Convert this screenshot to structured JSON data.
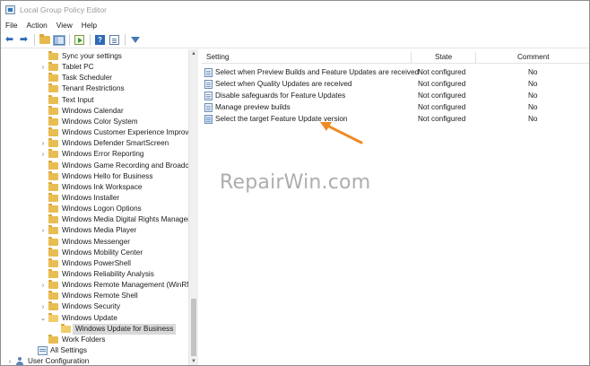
{
  "window": {
    "title": "Local Group Policy Editor"
  },
  "menu": [
    "File",
    "Action",
    "View",
    "Help"
  ],
  "toolbar": {
    "buttons": [
      "back-arrow-icon",
      "forward-arrow-icon",
      "up-folder-icon",
      "show-hide-tree-icon",
      "export-list-icon",
      "help-icon",
      "properties-icon",
      "filter-icon"
    ],
    "help_glyph": "?"
  },
  "tree": {
    "items": [
      {
        "label": "Sync your settings",
        "expandable": false
      },
      {
        "label": "Tablet PC",
        "expandable": true
      },
      {
        "label": "Task Scheduler",
        "expandable": false
      },
      {
        "label": "Tenant Restrictions",
        "expandable": false
      },
      {
        "label": "Text Input",
        "expandable": false
      },
      {
        "label": "Windows Calendar",
        "expandable": false
      },
      {
        "label": "Windows Color System",
        "expandable": false
      },
      {
        "label": "Windows Customer Experience Improve",
        "expandable": false
      },
      {
        "label": "Windows Defender SmartScreen",
        "expandable": true
      },
      {
        "label": "Windows Error Reporting",
        "expandable": true
      },
      {
        "label": "Windows Game Recording and Broadca",
        "expandable": false
      },
      {
        "label": "Windows Hello for Business",
        "expandable": false
      },
      {
        "label": "Windows Ink Workspace",
        "expandable": false
      },
      {
        "label": "Windows Installer",
        "expandable": false
      },
      {
        "label": "Windows Logon Options",
        "expandable": false
      },
      {
        "label": "Windows Media Digital Rights Manager",
        "expandable": false
      },
      {
        "label": "Windows Media Player",
        "expandable": true
      },
      {
        "label": "Windows Messenger",
        "expandable": false
      },
      {
        "label": "Windows Mobility Center",
        "expandable": false
      },
      {
        "label": "Windows PowerShell",
        "expandable": false
      },
      {
        "label": "Windows Reliability Analysis",
        "expandable": false
      },
      {
        "label": "Windows Remote Management (WinRM",
        "expandable": true
      },
      {
        "label": "Windows Remote Shell",
        "expandable": false
      },
      {
        "label": "Windows Security",
        "expandable": true
      },
      {
        "label": "Windows Update",
        "expandable": true,
        "expanded": true
      },
      {
        "label": "Windows Update for Business",
        "child": true,
        "selected": true
      },
      {
        "label": "Work Folders",
        "expandable": false
      },
      {
        "label": "All Settings",
        "settings": true
      },
      {
        "label": "User Configuration",
        "user": true
      }
    ],
    "expander_closed": "›",
    "expander_open": "⌄"
  },
  "list": {
    "headers": {
      "setting": "Setting",
      "state": "State",
      "comment": "Comment"
    },
    "rows": [
      {
        "setting": "Select when Preview Builds and Feature Updates are received",
        "state": "Not configured",
        "comment": "No"
      },
      {
        "setting": "Select when Quality Updates are received",
        "state": "Not configured",
        "comment": "No"
      },
      {
        "setting": "Disable safeguards for Feature Updates",
        "state": "Not configured",
        "comment": "No"
      },
      {
        "setting": "Manage preview builds",
        "state": "Not configured",
        "comment": "No"
      },
      {
        "setting": "Select the target Feature Update version",
        "state": "Not configured",
        "comment": "No",
        "selected": true
      }
    ]
  },
  "watermark": "RepairWin.com",
  "colors": {
    "annotation_arrow": "#f08a24",
    "selection": "#d9d9d9",
    "folder": "#e8bd52"
  }
}
